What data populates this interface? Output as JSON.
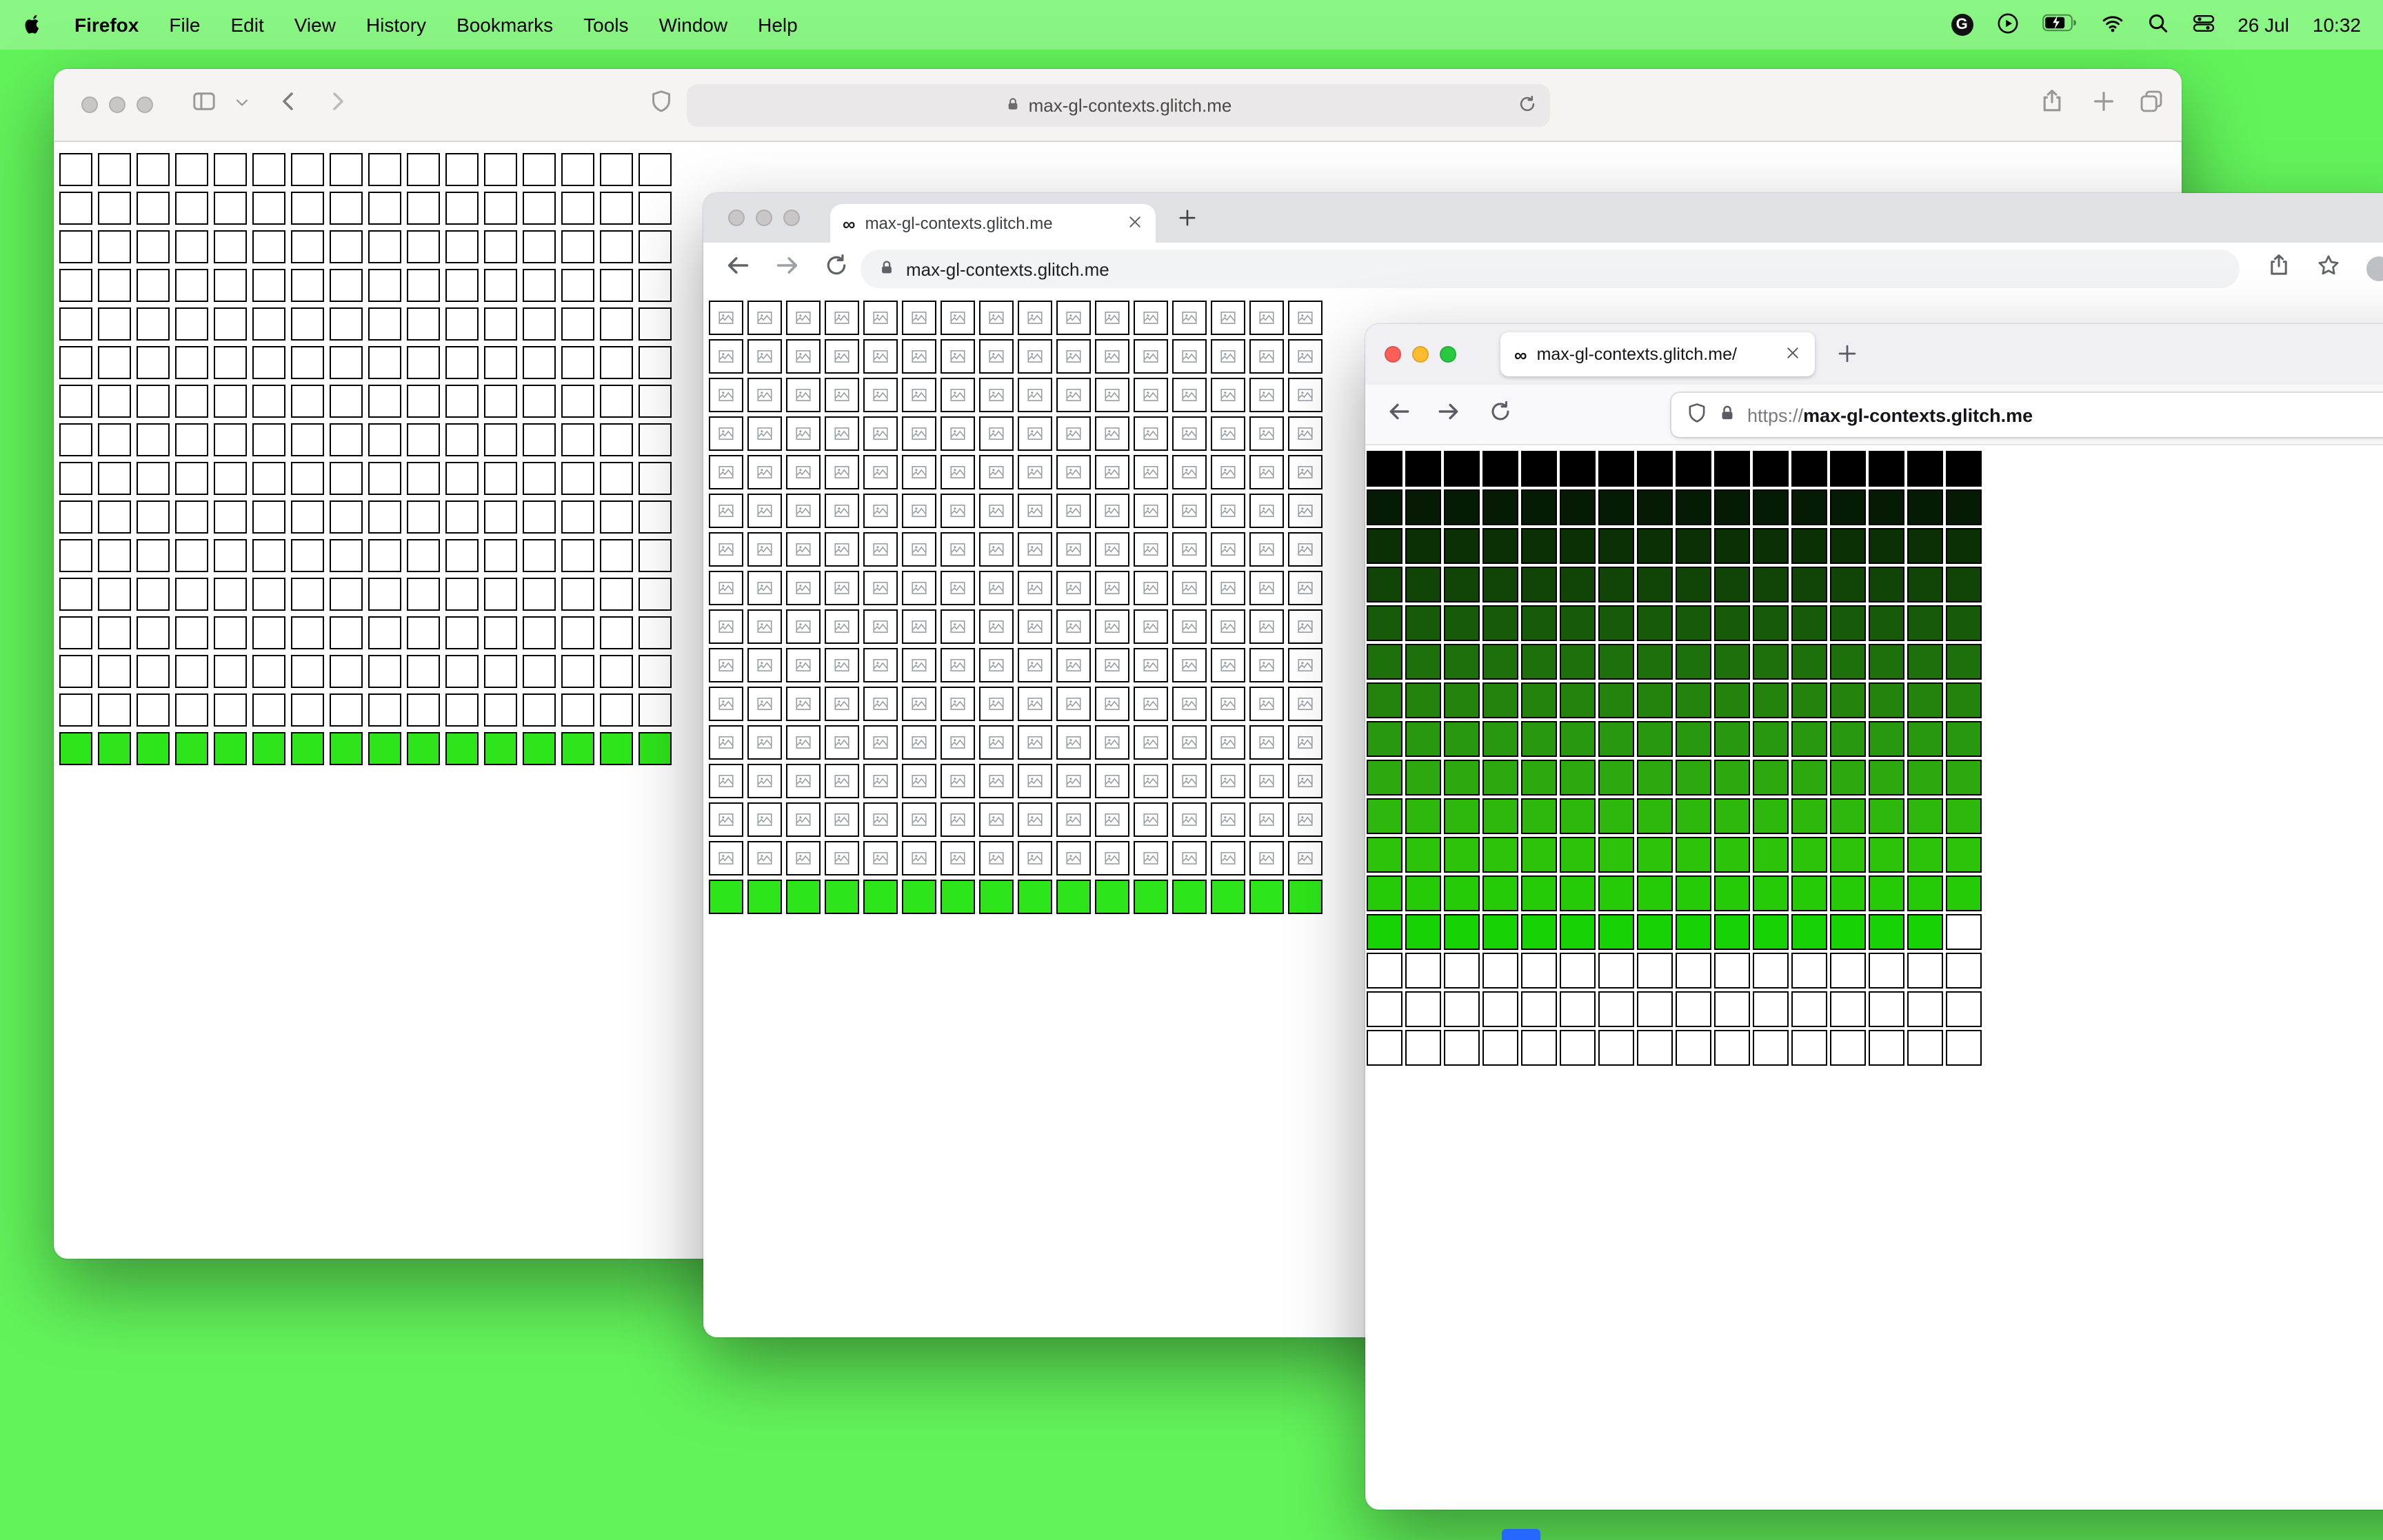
{
  "menubar": {
    "app_name": "Firefox",
    "menus": [
      "File",
      "Edit",
      "View",
      "History",
      "Bookmarks",
      "Tools",
      "Window",
      "Help"
    ],
    "date": "26 Jul",
    "time": "10:32",
    "grammarly_letter": "G"
  },
  "safari": {
    "url": "max-gl-contexts.glitch.me",
    "grid": {
      "cols": 16,
      "cell": 24,
      "gap": 4,
      "border": "#000000",
      "rows": [
        {
          "repeat": 15,
          "color": "#ffffff"
        },
        {
          "color": "#2ee41a"
        }
      ]
    }
  },
  "chrome": {
    "favicon": "∞",
    "tab_title": "max-gl-contexts.glitch.me",
    "url": "max-gl-contexts.glitch.me",
    "grid": {
      "cols": 16,
      "cell": 25,
      "gap": 3,
      "border": "#000000",
      "rows": [
        {
          "repeat": 15,
          "color": "#ffffff",
          "icon": true
        },
        {
          "color": "#2ee41a"
        }
      ]
    }
  },
  "firefox": {
    "favicon": "∞",
    "tab_title": "max-gl-contexts.glitch.me/",
    "url_scheme": "https://",
    "url_host": "max-gl-contexts.glitch.me",
    "grid": {
      "cols": 16,
      "cell": 26,
      "gap": 2,
      "border": "#000000",
      "rows": [
        {
          "color": "#000000"
        },
        {
          "color": "#051b03"
        },
        {
          "color": "#0b3005"
        },
        {
          "color": "#114507"
        },
        {
          "color": "#175a09"
        },
        {
          "color": "#1d6f0b"
        },
        {
          "color": "#23840d"
        },
        {
          "color": "#28990f"
        },
        {
          "color": "#2ca90e"
        },
        {
          "color": "#2eb70c"
        },
        {
          "color": "#2cc309"
        },
        {
          "color": "#24cb06"
        },
        {
          "color": "#17d204",
          "last_cell_color": "#ffffff"
        },
        {
          "repeat": 3,
          "color": "#ffffff"
        }
      ]
    }
  }
}
